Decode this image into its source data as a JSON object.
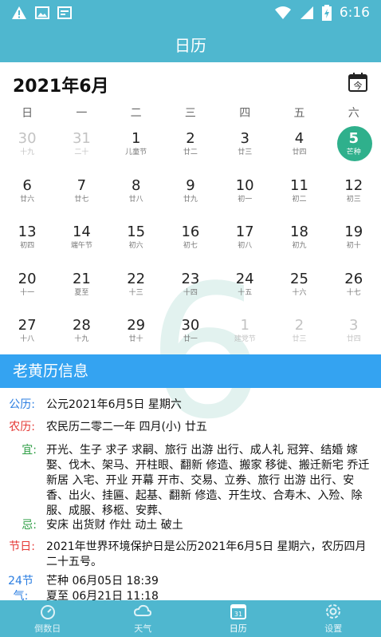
{
  "status_bar": {
    "icons_left": [
      "warning-icon",
      "image-icon",
      "screenshot-icon"
    ],
    "icons_right": [
      "wifi-icon",
      "signal-icon",
      "battery-charging-icon"
    ],
    "time": "6:16"
  },
  "header": {
    "title": "日历"
  },
  "calendar": {
    "month_title": "2021年6月",
    "today_icon_label": "今",
    "big_day": "6",
    "weekdays": [
      "日",
      "一",
      "二",
      "三",
      "四",
      "五",
      "六"
    ],
    "days": [
      {
        "d": "30",
        "s": "十九",
        "other": true
      },
      {
        "d": "31",
        "s": "二十",
        "other": true
      },
      {
        "d": "1",
        "s": "儿童节"
      },
      {
        "d": "2",
        "s": "廿二"
      },
      {
        "d": "3",
        "s": "廿三"
      },
      {
        "d": "4",
        "s": "廿四"
      },
      {
        "d": "5",
        "s": "芒种",
        "selected": true
      },
      {
        "d": "6",
        "s": "廿六"
      },
      {
        "d": "7",
        "s": "廿七"
      },
      {
        "d": "8",
        "s": "廿八"
      },
      {
        "d": "9",
        "s": "廿九"
      },
      {
        "d": "10",
        "s": "初一"
      },
      {
        "d": "11",
        "s": "初二"
      },
      {
        "d": "12",
        "s": "初三"
      },
      {
        "d": "13",
        "s": "初四"
      },
      {
        "d": "14",
        "s": "端午节"
      },
      {
        "d": "15",
        "s": "初六"
      },
      {
        "d": "16",
        "s": "初七"
      },
      {
        "d": "17",
        "s": "初八"
      },
      {
        "d": "18",
        "s": "初九"
      },
      {
        "d": "19",
        "s": "初十"
      },
      {
        "d": "20",
        "s": "十一"
      },
      {
        "d": "21",
        "s": "夏至"
      },
      {
        "d": "22",
        "s": "十三"
      },
      {
        "d": "23",
        "s": "十四"
      },
      {
        "d": "24",
        "s": "十五"
      },
      {
        "d": "25",
        "s": "十六"
      },
      {
        "d": "26",
        "s": "十七"
      },
      {
        "d": "27",
        "s": "十八"
      },
      {
        "d": "28",
        "s": "十九"
      },
      {
        "d": "29",
        "s": "廿十"
      },
      {
        "d": "30",
        "s": "廿一"
      },
      {
        "d": "1",
        "s": "建党节",
        "other": true
      },
      {
        "d": "2",
        "s": "廿三",
        "other": true
      },
      {
        "d": "3",
        "s": "廿四",
        "other": true
      }
    ]
  },
  "info": {
    "section_title": "老黄历信息",
    "gongli_label": "公历:",
    "gongli_value": "公元2021年6月5日 星期六",
    "nongli_label": "农历:",
    "nongli_value": "农民历二零二一年 四月(小) 廿五",
    "yi_label": "宜:",
    "yi_value": "开光、生子 求子 求嗣、旅行 出游 出行、成人礼 冠笄、结婚 嫁娶、伐木、架马、开柱眼、翻新 修造、搬家 移徙、搬迁新宅 乔迁新居 入宅、开业 开幕 开市、交易、立券、旅行 出游 出行、安香、出火、挂匾、起基、翻新 修造、开生坟、合寿木、入殓、除服、成服、移柩、安葬、",
    "ji_label": "忌:",
    "ji_value": "安床 出货财 作灶 动土 破土",
    "jieri_label": "节日:",
    "jieri_value": "2021年世界环境保护日是公历2021年6月5日 星期六，农历四月二十五号。",
    "jieqi_label": "24节气:",
    "jieqi_lines": [
      "芒种 06月05日 18:39",
      "夏至 06月21日 11:18"
    ],
    "colors": {
      "gongli": "#2a7de1",
      "nongli": "#e53935",
      "yi": "#2e9e44",
      "ji": "#2e9e44",
      "jieri": "#e53935",
      "jieqi": "#2a7de1"
    }
  },
  "tabs": [
    {
      "label": "倒数日",
      "icon": "countdown-icon"
    },
    {
      "label": "天气",
      "icon": "weather-icon"
    },
    {
      "label": "日历",
      "icon": "calendar-tab-icon",
      "active": true
    },
    {
      "label": "设置",
      "icon": "settings-icon"
    }
  ]
}
